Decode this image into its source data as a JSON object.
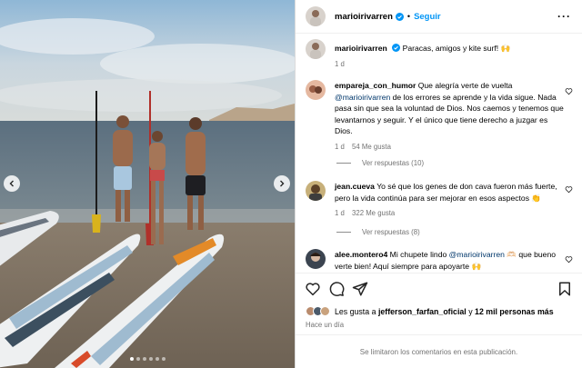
{
  "post": {
    "author": "marioirivarren",
    "follow_label": "Seguir",
    "separator": "•",
    "caption": "Paracas, amigos y kite surf! 🙌",
    "caption_time": "1 d"
  },
  "comments": [
    {
      "user": "empareja_con_humor",
      "text_before": "Que alegría verte de vuelta",
      "mention": "@marioirivarren",
      "text_after": "de los errores se aprende y la vida sigue. Nada pasa sin que sea la voluntad de Dios. Nos caemos y tenemos que levantarnos y seguir. Y el único que tiene derecho a juzgar es Dios.",
      "time": "1 d",
      "likes": "54 Me gusta",
      "replies": "Ver respuestas (10)"
    },
    {
      "user": "jean.cueva",
      "text_before": "Yo sé que los genes de don cava fueron más fuerte, pero la vida continúa para ser mejorar en esos aspectos 👏",
      "mention": "",
      "text_after": "",
      "time": "1 d",
      "likes": "322 Me gusta",
      "replies": "Ver respuestas (8)"
    },
    {
      "user": "alee.montero4",
      "text_before": "Mi chupete lindo",
      "mention": "@marioirivarren",
      "text_after": "🫶🏻 que bueno verte bien! Aquí siempre para apoyarte 🙌",
      "time": "",
      "likes": "",
      "replies": ""
    }
  ],
  "likes_line": {
    "prefix": "Les gusta a",
    "user": "jefferson_farfan_oficial",
    "middle": "y",
    "count": "12 mil personas más"
  },
  "post_time": "Hace un día",
  "footer": "Se limitaron los comentarios en esta publicación.",
  "icons": [
    "more-icon",
    "verified-icon",
    "heart-icon",
    "comment-icon",
    "share-icon",
    "save-icon",
    "chevron-left-icon",
    "chevron-right-icon"
  ],
  "colors": {
    "accent": "#0095f6",
    "mention": "#00376b",
    "muted": "#737373",
    "verified": "#0095f6"
  }
}
